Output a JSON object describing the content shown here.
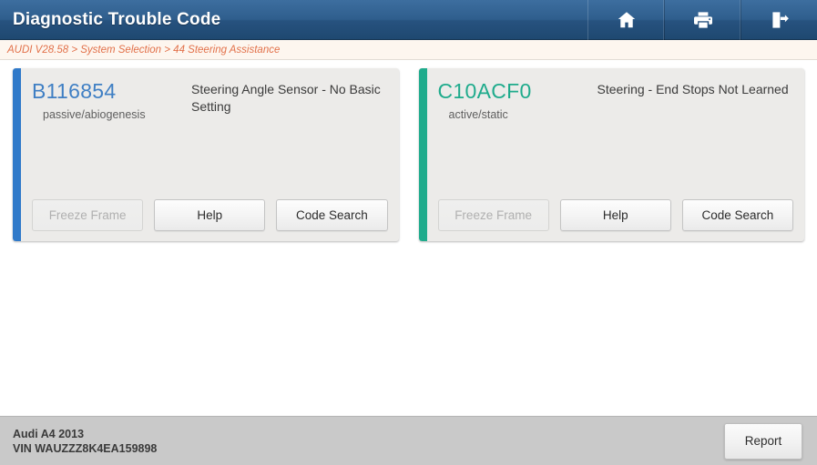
{
  "window": {
    "title": "Diagnostic Trouble Code"
  },
  "header": {
    "actions": [
      {
        "name": "home-icon",
        "label": "Home"
      },
      {
        "name": "print-icon",
        "label": "Print"
      },
      {
        "name": "exit-icon",
        "label": "Exit"
      }
    ]
  },
  "breadcrumb": {
    "text": "AUDI V28.58 > System Selection > 44 Steering Assistance",
    "color": "#e2714a"
  },
  "main": {
    "cards": [
      {
        "code": "B116854",
        "code_color": "#3f7fc4",
        "accent_color": "#2f79c9",
        "status": "passive/abiogenesis",
        "description": "Steering Angle Sensor - No Basic Setting",
        "buttons": [
          {
            "label": "Freeze Frame",
            "disabled": true
          },
          {
            "label": "Help",
            "disabled": false
          },
          {
            "label": "Code Search",
            "disabled": false
          }
        ]
      },
      {
        "code": "C10ACF0",
        "code_color": "#1fab8c",
        "accent_color": "#1fab8c",
        "status": "active/static",
        "description": "Steering - End Stops Not Learned",
        "buttons": [
          {
            "label": "Freeze Frame",
            "disabled": true
          },
          {
            "label": "Help",
            "disabled": false
          },
          {
            "label": "Code Search",
            "disabled": false
          }
        ]
      }
    ]
  },
  "footer": {
    "vehicle": "Audi A4 2013",
    "vin": "VIN WAUZZZ8K4EA159898",
    "report_label": "Report"
  }
}
